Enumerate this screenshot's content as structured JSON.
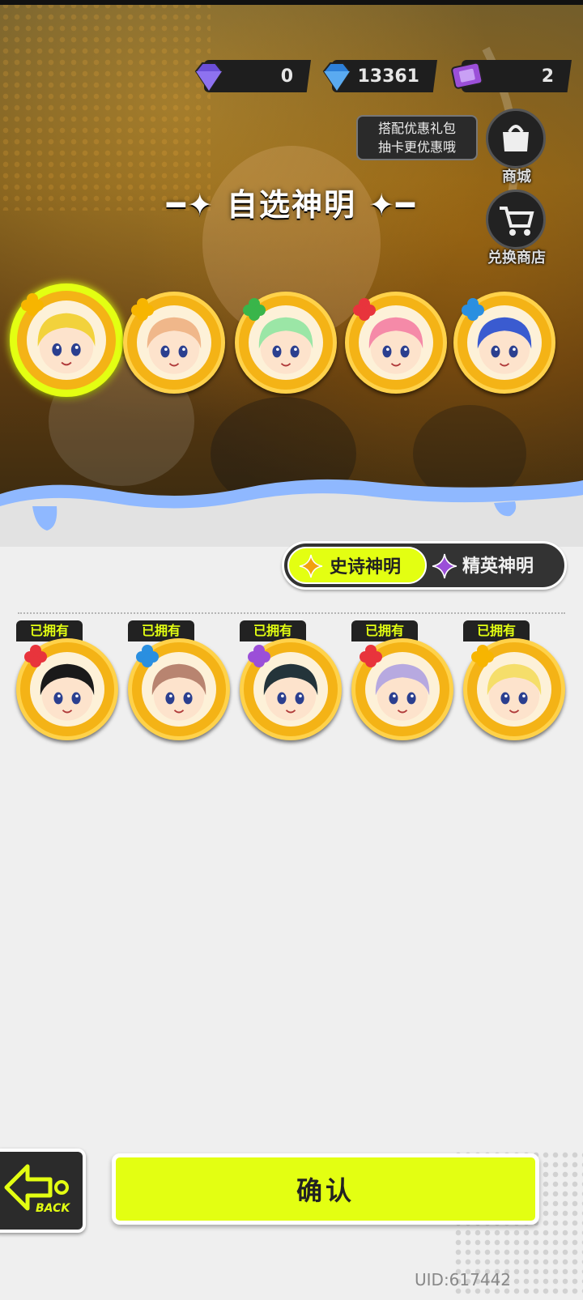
{
  "currency": [
    {
      "icon": "purple-diamond-icon",
      "value": "0"
    },
    {
      "icon": "blue-diamond-icon",
      "value": "13361"
    },
    {
      "icon": "ticket-icon",
      "value": "2"
    }
  ],
  "promo": {
    "line1": "搭配优惠礼包",
    "line2": "抽卡更优惠哦"
  },
  "shop": {
    "mall_label": "商城",
    "exchange_label": "兑换商店"
  },
  "title": "自选神明",
  "tabs": {
    "epic": "史诗神明",
    "elite": "精英神明"
  },
  "owned_label": "已拥有",
  "confirm_label": "确认",
  "back_label": "BACK",
  "uid": "UID:617442",
  "colors": {
    "accent": "#e3ff12",
    "gold": "#f4b316"
  },
  "selectable": [
    {
      "name": "god-1",
      "flower": "#f7b500",
      "hair": "#f2d23c",
      "selected": true
    },
    {
      "name": "god-2",
      "flower": "#f7b500",
      "hair": "#f0b78a",
      "selected": false
    },
    {
      "name": "god-3",
      "flower": "#39b54a",
      "hair": "#9be6a6",
      "selected": false
    },
    {
      "name": "god-4",
      "flower": "#e8343c",
      "hair": "#f58aa8",
      "selected": false
    },
    {
      "name": "god-5",
      "flower": "#2a8fe0",
      "hair": "#3a5bd0",
      "selected": false
    }
  ],
  "owned": [
    {
      "name": "owned-1",
      "flower": "#e8343c",
      "hair": "#1a1a1a"
    },
    {
      "name": "owned-2",
      "flower": "#2a8fe0",
      "hair": "#b88470"
    },
    {
      "name": "owned-3",
      "flower": "#9b4fd8",
      "hair": "#24343a"
    },
    {
      "name": "owned-4",
      "flower": "#e8343c",
      "hair": "#b7a9e0"
    },
    {
      "name": "owned-5",
      "flower": "#f7b500",
      "hair": "#f5de6a"
    }
  ]
}
